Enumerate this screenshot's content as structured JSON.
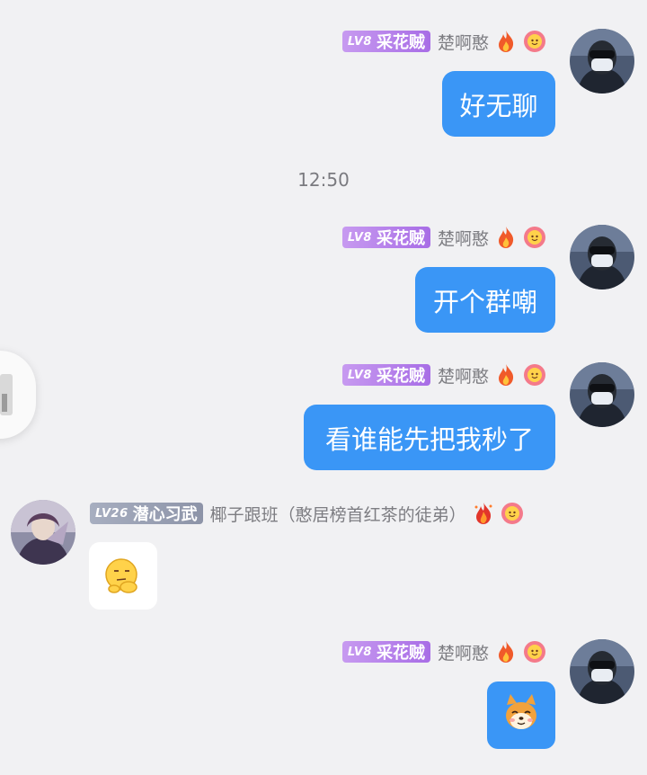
{
  "timestamp": "12:50",
  "messages": [
    {
      "side": "right",
      "badge": {
        "level": "LV8",
        "title": "采花贼",
        "color": "#b07ee8"
      },
      "nickname": "楚啊憨",
      "text": "好无聊"
    },
    {
      "side": "right",
      "badge": {
        "level": "LV8",
        "title": "采花贼",
        "color": "#b07ee8"
      },
      "nickname": "楚啊憨",
      "text": "开个群嘲"
    },
    {
      "side": "right",
      "badge": {
        "level": "LV8",
        "title": "采花贼",
        "color": "#b07ee8"
      },
      "nickname": "楚啊憨",
      "text": "看谁能先把我秒了"
    },
    {
      "side": "left",
      "badge": {
        "level": "LV26",
        "title": "潜心习武",
        "color": "#9aa0b3"
      },
      "nickname": "椰子跟班（憨居榜首红茶的徒弟）",
      "sticker": "thinking-face-sticker"
    },
    {
      "side": "right",
      "badge": {
        "level": "LV8",
        "title": "采花贼",
        "color": "#b07ee8"
      },
      "nickname": "楚啊憨",
      "sticker": "shiba-dog-sticker"
    }
  ],
  "colors": {
    "bubble_blue": "#3a96f6",
    "background": "#f1f1f3"
  }
}
